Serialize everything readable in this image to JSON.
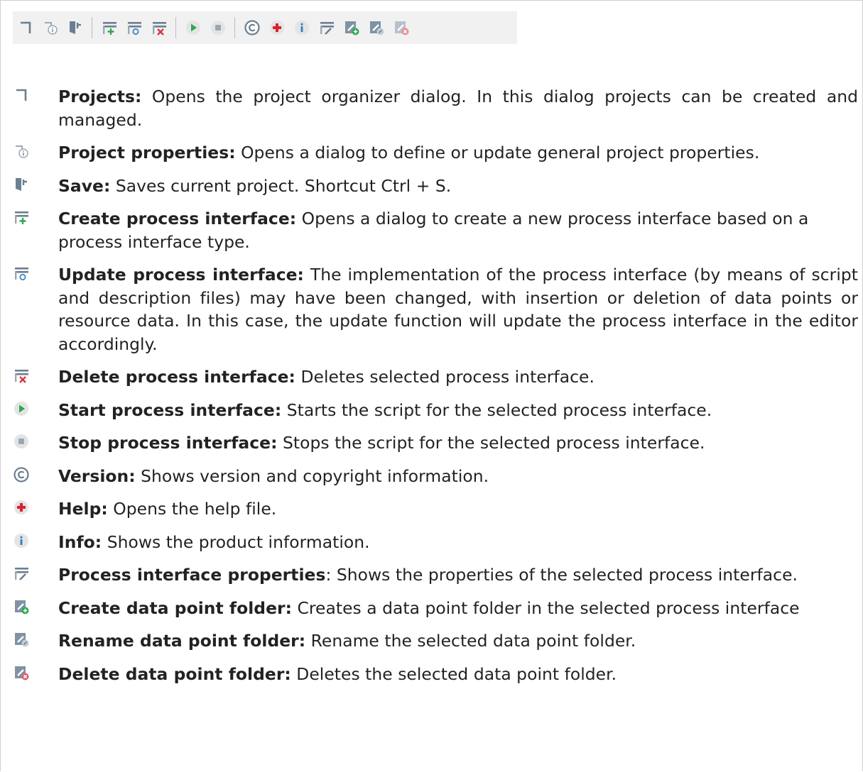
{
  "toolbar": {
    "buttons": [
      {
        "icon": "projects-icon",
        "label": "Projects"
      },
      {
        "icon": "project-properties-icon",
        "label": "Project properties"
      },
      {
        "icon": "save-icon",
        "label": "Save"
      },
      {
        "icon": "create-process-interface-icon",
        "label": "Create process interface"
      },
      {
        "icon": "update-process-interface-icon",
        "label": "Update process interface"
      },
      {
        "icon": "delete-process-interface-icon",
        "label": "Delete process interface"
      },
      {
        "icon": "start-icon",
        "label": "Start process interface"
      },
      {
        "icon": "stop-icon",
        "label": "Stop process interface"
      },
      {
        "icon": "copyright-icon",
        "label": "Version"
      },
      {
        "icon": "help-icon",
        "label": "Help"
      },
      {
        "icon": "info-icon",
        "label": "Info"
      },
      {
        "icon": "process-interface-properties-icon",
        "label": "Process interface properties"
      },
      {
        "icon": "create-folder-icon",
        "label": "Create data point folder"
      },
      {
        "icon": "rename-folder-icon",
        "label": "Rename data point folder"
      },
      {
        "icon": "delete-folder-icon",
        "label": "Delete data point folder"
      }
    ]
  },
  "items": [
    {
      "title": "Projects:",
      "text": " Opens the project organizer dialog. In this dialog projects can be created and managed."
    },
    {
      "title": "Project properties:",
      "text": " Opens a dialog to define or update general project properties."
    },
    {
      "title": "Save:",
      "text": " Saves current project. Shortcut Ctrl + S."
    },
    {
      "title": "Create process interface:",
      "text": " Opens a dialog to create a new process interface based on a process interface type."
    },
    {
      "title": "Update process interface:",
      "text": " The implementation of the process interface (by means of script and description files) may have been changed, with insertion or deletion of data points or resource data. In this case, the update function will update the process interface in the editor accordingly."
    },
    {
      "title": "Delete process interface:",
      "text": " Deletes selected process interface."
    },
    {
      "title": "Start process interface:",
      "text": " Starts the script for the selected process interface."
    },
    {
      "title": "Stop process interface:",
      "text": " Stops the script for the selected process interface."
    },
    {
      "title": "Version:",
      "text": " Shows version and copyright information."
    },
    {
      "title": "Help:",
      "text": " Opens the help file."
    },
    {
      "title": "Info:",
      "text": " Shows the product information."
    },
    {
      "title": "Process interface properties",
      "text": ": Shows the properties of the selected process interface."
    },
    {
      "title": "Create data point folder:",
      "text": " Creates a data point folder in the selected process interface"
    },
    {
      "title": "Rename data point folder:",
      "text": " Rename the selected data point folder."
    },
    {
      "title": "Delete data point folder:",
      "text": " Deletes the selected data point folder."
    }
  ]
}
